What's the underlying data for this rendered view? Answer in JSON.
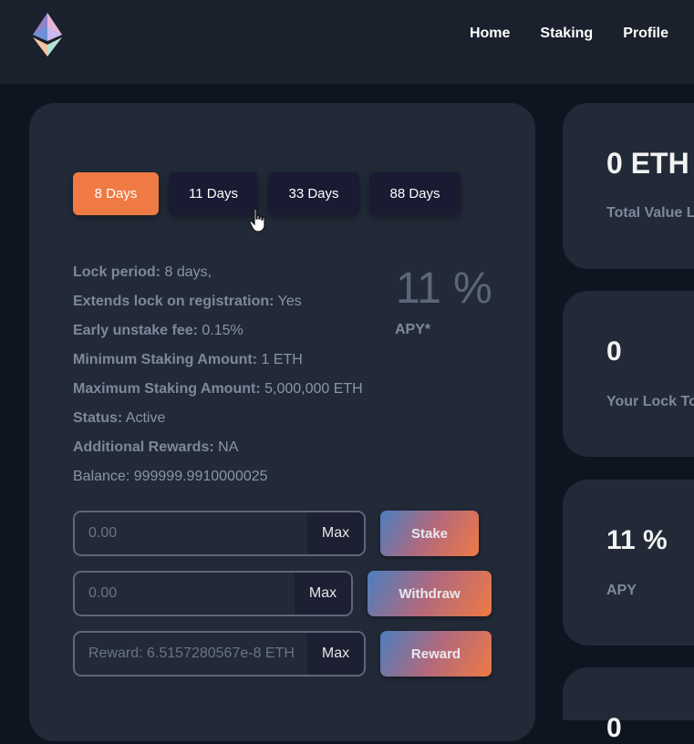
{
  "nav": {
    "home": "Home",
    "staking": "Staking",
    "profile": "Profile"
  },
  "tabs": [
    {
      "label": "8 Days",
      "active": true
    },
    {
      "label": "11 Days",
      "active": false
    },
    {
      "label": "33 Days",
      "active": false
    },
    {
      "label": "88 Days",
      "active": false
    }
  ],
  "details": {
    "lock_period": {
      "label": "Lock period:",
      "value": "8 days,"
    },
    "extends_lock": {
      "label": "Extends lock on registration:",
      "value": "Yes"
    },
    "early_fee": {
      "label": "Early unstake fee:",
      "value": "0.15%"
    },
    "min_amount": {
      "label": "Minimum Staking Amount:",
      "value": "1 ETH"
    },
    "max_amount": {
      "label": "Maximum Staking Amount:",
      "value": "5,000,000 ETH"
    },
    "status": {
      "label": "Status:",
      "value": "Active"
    },
    "additional_rewards": {
      "label": "Additional Rewards:",
      "value": "NA"
    },
    "balance": "Balance: 999999.9910000025"
  },
  "apy": {
    "value": "11 %",
    "label": "APY*"
  },
  "actions": {
    "stake": {
      "placeholder": "0.00",
      "max_label": "Max",
      "button_label": "Stake"
    },
    "withdraw": {
      "placeholder": "0.00",
      "max_label": "Max",
      "button_label": "Withdraw"
    },
    "reward": {
      "placeholder": "Reward: 6.5157280567e-8 ETH",
      "max_label": "Max",
      "button_label": "Reward"
    }
  },
  "side_cards": [
    {
      "value": "0 ETH",
      "label": "Total Value L"
    },
    {
      "value": "0",
      "label": "Your Lock To"
    },
    {
      "value": "11 %",
      "label": "APY"
    },
    {
      "value": "0",
      "label": ""
    }
  ],
  "colors": {
    "accent": "#ef7a44",
    "tab_bg": "#1a1a33",
    "card_bg": "#222a38",
    "page_bg": "#0f1520",
    "header_bg": "#1a202c"
  },
  "icons": {
    "logo": "ethereum-logo-icon",
    "cursor": "hand-pointer-icon"
  }
}
